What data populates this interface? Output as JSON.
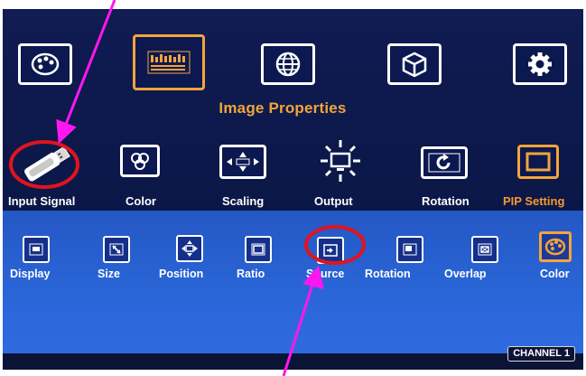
{
  "menu": {
    "title": "Image Properties",
    "categories": [
      {
        "name": "palette-icon"
      },
      {
        "name": "image-properties-icon",
        "active": true
      },
      {
        "name": "globe-icon"
      },
      {
        "name": "cube-icon"
      },
      {
        "name": "gear-icon"
      }
    ],
    "items": [
      {
        "label": "Input Signal",
        "icon": "usb-plug-icon"
      },
      {
        "label": "Color",
        "icon": "color-circles-icon"
      },
      {
        "label": "Scaling",
        "icon": "scaling-arrows-icon"
      },
      {
        "label": "Output",
        "icon": "output-monitor-icon"
      },
      {
        "label": "Rotation",
        "icon": "rotation-icon"
      },
      {
        "label": "PIP Setting",
        "icon": "pip-icon",
        "active": true
      }
    ],
    "sub_items": [
      {
        "label": "Display",
        "icon": "display-icon"
      },
      {
        "label": "Size",
        "icon": "size-icon"
      },
      {
        "label": "Position",
        "icon": "position-icon"
      },
      {
        "label": "Ratio",
        "icon": "ratio-icon"
      },
      {
        "label": "Source",
        "icon": "source-icon"
      },
      {
        "label": "Rotation",
        "icon": "rotation-sub-icon"
      },
      {
        "label": "Overlap",
        "icon": "overlap-icon"
      },
      {
        "label": "Color",
        "icon": "color-sub-icon",
        "active": true
      }
    ]
  },
  "status": {
    "channel": "CHANNEL 1"
  },
  "colors": {
    "accent": "#f3a43a",
    "highlight_circle": "#e0141e",
    "annotation_arrow": "#ff17f0",
    "panel_dark": "#0d1a4e",
    "panel_blue": "#2a66d8"
  }
}
